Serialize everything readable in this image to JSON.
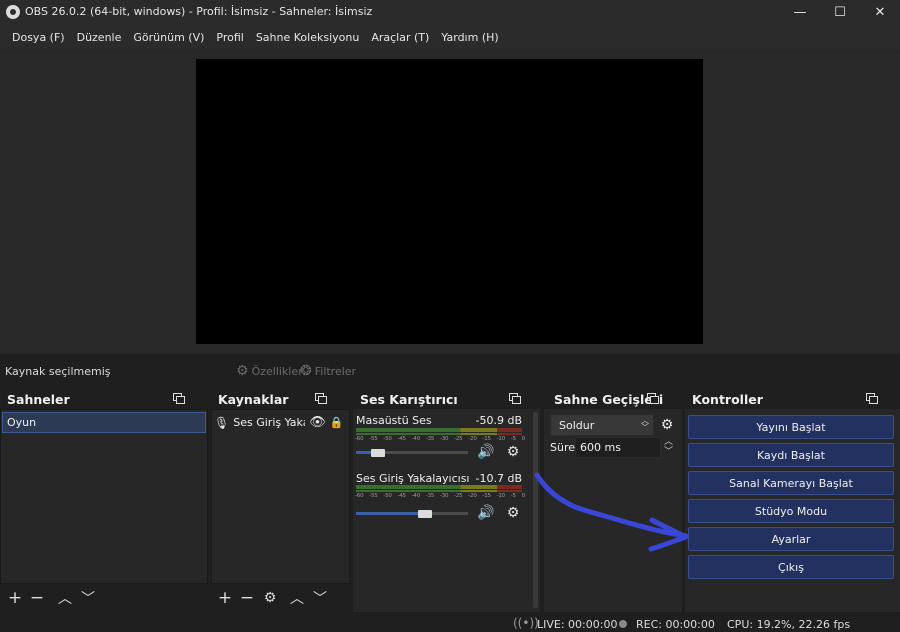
{
  "window": {
    "title": "OBS 26.0.2 (64-bit, windows) - Profil: İsimsiz - Sahneler: İsimsiz",
    "minimize": "—",
    "maximize": "☐",
    "close": "✕"
  },
  "menu": {
    "items": [
      "Dosya (F)",
      "Düzenle",
      "Görünüm (V)",
      "Profil",
      "Sahne Koleksiyonu",
      "Araçlar (T)",
      "Yardım (H)"
    ]
  },
  "source_bar": {
    "no_source": "Kaynak seçilmemiş",
    "properties": "Özellikler",
    "filters": "Filtreler"
  },
  "docks": {
    "scenes": {
      "title": "Sahneler",
      "items": [
        "Oyun"
      ]
    },
    "sources": {
      "title": "Kaynaklar",
      "items": [
        "Ses Giriş Yakalayıcısı"
      ]
    },
    "mixer": {
      "title": "Ses Karıştırıcı",
      "scale": [
        "-60",
        "-55",
        "-50",
        "-45",
        "-40",
        "-35",
        "-30",
        "-25",
        "-20",
        "-15",
        "-10",
        "-5",
        "0"
      ],
      "channels": [
        {
          "name": "Masaüstü Ses",
          "db": "-50.9 dB",
          "volume": 0.2
        },
        {
          "name": "Ses Giriş Yakalayıcısı",
          "db": "-10.7 dB",
          "volume": 0.62
        }
      ]
    },
    "transitions": {
      "title": "Sahne Geçişleri",
      "selected": "Soldur",
      "duration_label": "Süre",
      "duration_value": "600 ms"
    },
    "controls": {
      "title": "Kontroller",
      "buttons": [
        "Yayını Başlat",
        "Kaydı Başlat",
        "Sanal Kamerayı Başlat",
        "Stüdyo Modu",
        "Ayarlar",
        "Çıkış"
      ]
    }
  },
  "status": {
    "live": "LIVE: 00:00:00",
    "rec": "REC: 00:00:00",
    "cpu": "CPU: 19.2%, 22.26 fps"
  },
  "colors": {
    "accent": "#3d5fa8",
    "annotation_stroke": "#3a46d6",
    "control_button": "#233160"
  }
}
